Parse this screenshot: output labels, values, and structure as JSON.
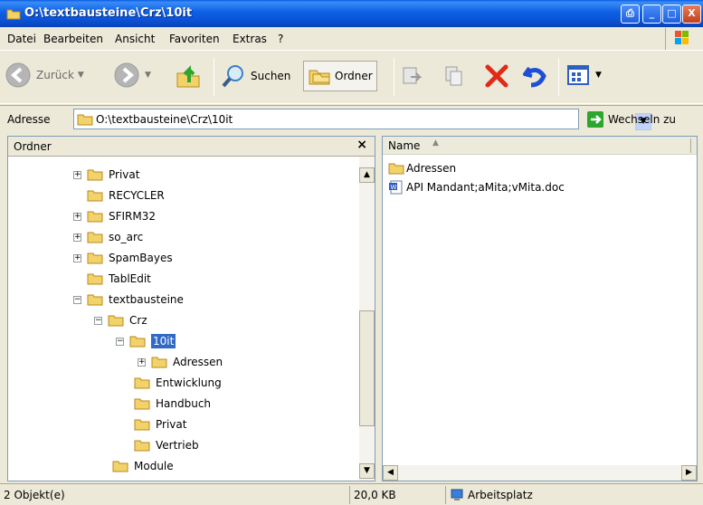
{
  "window": {
    "title": "O:\\textbausteine\\Crz\\10it",
    "buttons": {
      "minimize": "_",
      "maximize": "□",
      "close": "X"
    }
  },
  "menu": [
    {
      "label": "Datei"
    },
    {
      "label": "Bearbeiten"
    },
    {
      "label": "Ansicht"
    },
    {
      "label": "Favoriten"
    },
    {
      "label": "Extras"
    },
    {
      "label": "?"
    }
  ],
  "toolbar": {
    "back_label": "Zurück",
    "search_label": "Suchen",
    "folders_label": "Ordner"
  },
  "address": {
    "label": "Adresse",
    "value": "O:\\textbausteine\\Crz\\10it",
    "go_label": "Wechseln zu"
  },
  "tree_pane": {
    "title": "Ordner",
    "close_glyph": "×",
    "items": [
      {
        "label": "Privat",
        "expander": "+",
        "selected": false
      },
      {
        "label": "RECYCLER",
        "expander": "",
        "selected": false
      },
      {
        "label": "SFIRM32",
        "expander": "+",
        "selected": false
      },
      {
        "label": "so_arc",
        "expander": "+",
        "selected": false
      },
      {
        "label": "SpamBayes",
        "expander": "+",
        "selected": false
      },
      {
        "label": "TablEdit",
        "expander": "",
        "selected": false
      },
      {
        "label": "textbausteine",
        "expander": "−",
        "selected": false
      },
      {
        "label": "Crz",
        "expander": "−",
        "selected": false
      },
      {
        "label": "10it",
        "expander": "−",
        "selected": true
      },
      {
        "label": "Adressen",
        "expander": "+",
        "selected": false
      },
      {
        "label": "Entwicklung",
        "expander": "",
        "selected": false
      },
      {
        "label": "Handbuch",
        "expander": "",
        "selected": false
      },
      {
        "label": "Privat",
        "expander": "",
        "selected": false
      },
      {
        "label": "Vertrieb",
        "expander": "",
        "selected": false
      },
      {
        "label": "Module",
        "expander": "",
        "selected": false
      }
    ]
  },
  "file_pane": {
    "column_name": "Name",
    "files": [
      {
        "name": "Adressen",
        "icon": "folder-icon"
      },
      {
        "name": "API Mandant;aMita;vMita.doc",
        "icon": "word-doc-icon"
      }
    ]
  },
  "status": {
    "objects": "2 Objekt(e)",
    "size": "20,0 KB",
    "zone": "Arbeitsplatz"
  },
  "colors": {
    "titlebar": "#0B55D9",
    "selection": "#316AC5",
    "folder": "#F2D26B",
    "delete_red": "#E02A1A"
  }
}
